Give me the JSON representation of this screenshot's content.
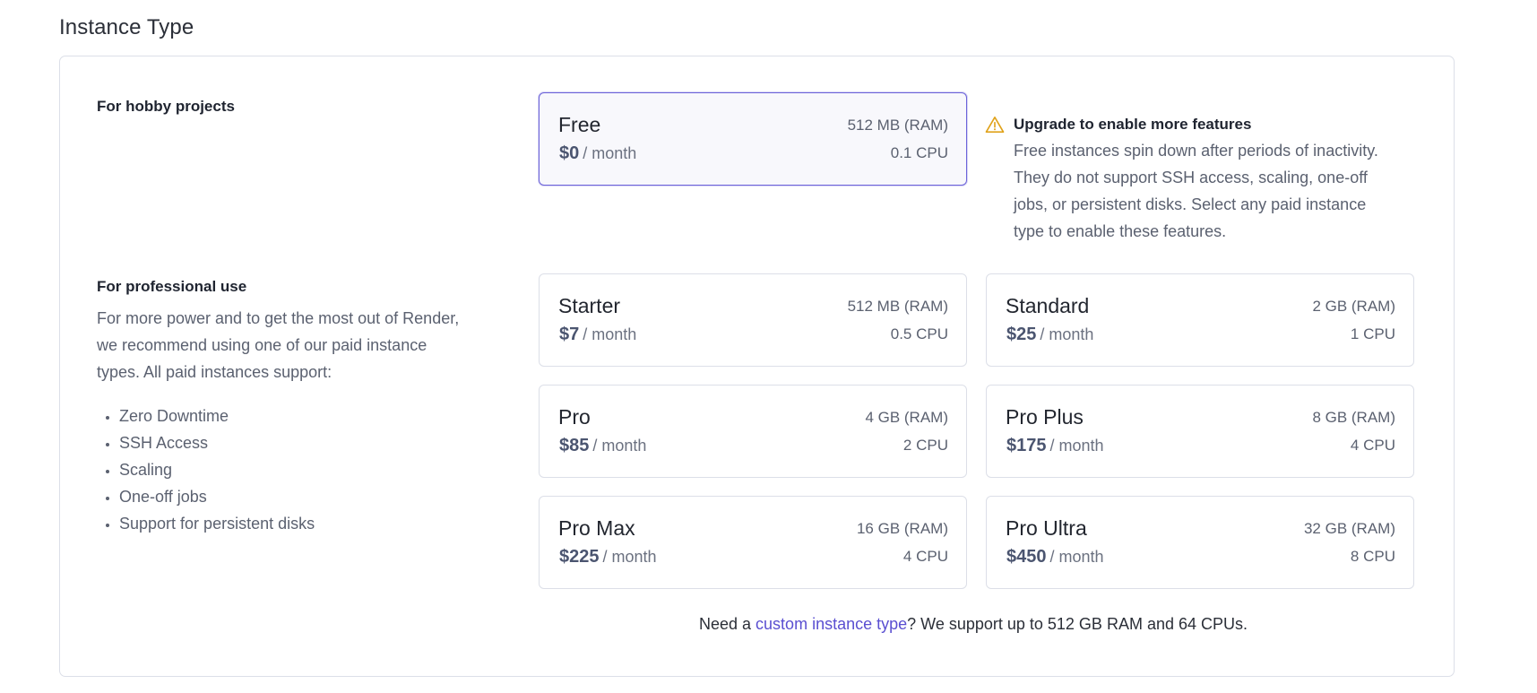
{
  "section": {
    "title": "Instance Type"
  },
  "hobby": {
    "heading": "For hobby projects"
  },
  "professional": {
    "heading": "For professional use",
    "description": "For more power and to get the most out of Render, we recommend using one of our paid instance types. All paid instances support:",
    "features": [
      "Zero Downtime",
      "SSH Access",
      "Scaling",
      "One-off jobs",
      "Support for persistent disks"
    ]
  },
  "notice": {
    "icon": "warning-triangle-icon",
    "icon_color": "#e0a21a",
    "title": "Upgrade to enable more features",
    "body": "Free instances spin down after periods of inactivity. They do not support SSH access, scaling, one-off jobs, or persistent disks. Select any paid instance type to enable these features."
  },
  "instances": [
    {
      "name": "Free",
      "price": "$0",
      "period": "/ month",
      "ram": "512 MB (RAM)",
      "cpu": "0.1 CPU",
      "selected": true
    },
    {
      "name": "Starter",
      "price": "$7",
      "period": "/ month",
      "ram": "512 MB (RAM)",
      "cpu": "0.5 CPU",
      "selected": false
    },
    {
      "name": "Standard",
      "price": "$25",
      "period": "/ month",
      "ram": "2 GB (RAM)",
      "cpu": "1 CPU",
      "selected": false
    },
    {
      "name": "Pro",
      "price": "$85",
      "period": "/ month",
      "ram": "4 GB (RAM)",
      "cpu": "2 CPU",
      "selected": false
    },
    {
      "name": "Pro Plus",
      "price": "$175",
      "period": "/ month",
      "ram": "8 GB (RAM)",
      "cpu": "4 CPU",
      "selected": false
    },
    {
      "name": "Pro Max",
      "price": "$225",
      "period": "/ month",
      "ram": "16 GB (RAM)",
      "cpu": "4 CPU",
      "selected": false
    },
    {
      "name": "Pro Ultra",
      "price": "$450",
      "period": "/ month",
      "ram": "32 GB (RAM)",
      "cpu": "8 CPU",
      "selected": false
    }
  ],
  "custom": {
    "prefix": "Need a ",
    "link_text": "custom instance type",
    "suffix": "? We support up to 512 GB RAM and 64 CPUs."
  },
  "colors": {
    "accent": "#6c63d9",
    "link": "#5a4fd1"
  }
}
